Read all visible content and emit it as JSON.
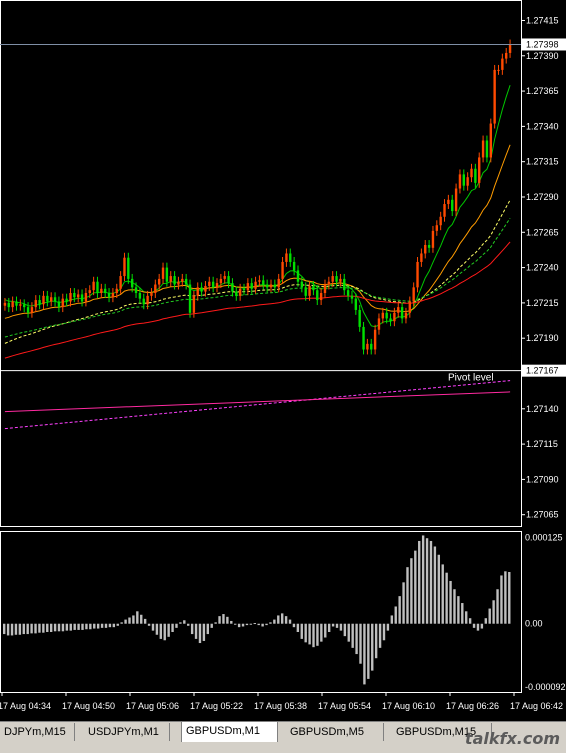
{
  "chart_data": [
    {
      "type": "candlestick",
      "symbol": "GBPUSDm,M1",
      "price_axis": {
        "ticks": [
          "1.27415",
          "1.27390",
          "1.27365",
          "1.27340",
          "1.27315",
          "1.27290",
          "1.27265",
          "1.27240",
          "1.27215",
          "1.27190",
          "1.27140",
          "1.27115",
          "1.27090",
          "1.27065"
        ],
        "range": [
          1.27057,
          1.27421
        ]
      },
      "current_price": "1.27398",
      "pivot": {
        "label": "Pivot level",
        "value": "1.27167"
      },
      "time_labels": [
        "17 Aug 04:34",
        "17 Aug 04:50",
        "17 Aug 05:06",
        "17 Aug 05:22",
        "17 Aug 05:38",
        "17 Aug 05:54",
        "17 Aug 06:10",
        "17 Aug 06:26",
        "17 Aug 06:42"
      ],
      "bull_color": "#ff4a00",
      "bear_color": "#00e000",
      "closes": [
        1.27215,
        1.27212,
        1.27216,
        1.27213,
        1.27214,
        1.27212,
        1.27208,
        1.27212,
        1.27217,
        1.27214,
        1.2722,
        1.27216,
        1.27219,
        1.27216,
        1.27212,
        1.27218,
        1.27216,
        1.27222,
        1.27219,
        1.27221,
        1.27216,
        1.27222,
        1.27224,
        1.2723,
        1.27222,
        1.27225,
        1.27222,
        1.27219,
        1.27222,
        1.27225,
        1.27234,
        1.27247,
        1.27232,
        1.27226,
        1.27222,
        1.27218,
        1.27214,
        1.2722,
        1.27222,
        1.27228,
        1.27232,
        1.2724,
        1.2723,
        1.27234,
        1.27228,
        1.2723,
        1.27232,
        1.27228,
        1.27208,
        1.2722,
        1.27226,
        1.27223,
        1.27227,
        1.2723,
        1.27226,
        1.27229,
        1.27232,
        1.27234,
        1.27229,
        1.27223,
        1.2722,
        1.27225,
        1.27224,
        1.27229,
        1.27225,
        1.2723,
        1.27231,
        1.27228,
        1.27226,
        1.27228,
        1.27226,
        1.27232,
        1.27244,
        1.2725,
        1.27244,
        1.27238,
        1.2723,
        1.27226,
        1.2722,
        1.27227,
        1.27224,
        1.27217,
        1.27222,
        1.27228,
        1.2723,
        1.27234,
        1.2723,
        1.27232,
        1.27224,
        1.2722,
        1.27218,
        1.2721,
        1.27198,
        1.27182,
        1.27186,
        1.27182,
        1.27196,
        1.27204,
        1.27208,
        1.27204,
        1.27202,
        1.27208,
        1.27212,
        1.27204,
        1.27208,
        1.27216,
        1.27226,
        1.27244,
        1.2725,
        1.27256,
        1.27254,
        1.27266,
        1.2727,
        1.27276,
        1.27285,
        1.27288,
        1.2728,
        1.27296,
        1.27306,
        1.27298,
        1.27304,
        1.2731,
        1.273,
        1.27318,
        1.2733,
        1.27318,
        1.27342,
        1.2738,
        1.2738,
        1.27388,
        1.27392,
        1.27398
      ],
      "moving_averages": [
        {
          "color": "#00c800",
          "style": "solid"
        },
        {
          "color": "#ff9c00",
          "style": "solid"
        },
        {
          "color": "#ffff66",
          "style": "dashed"
        },
        {
          "color": "#ff1a1a",
          "style": "solid"
        },
        {
          "color": "#22cc22",
          "style": "dashed"
        },
        {
          "color": "#ff40ff",
          "style": "dashed"
        },
        {
          "color": "#ff2aa0",
          "style": "solid"
        }
      ]
    },
    {
      "type": "histogram",
      "indicator_axis": {
        "ticks": [
          "0.000125",
          "0.00",
          "-0.000092"
        ],
        "range": [
          -9.9e-05,
          0.000133
        ]
      },
      "color": "#bfbfbf",
      "values": [
        -1.5e-05,
        -1.7e-05,
        -1.7e-05,
        -1.6e-05,
        -1.6e-05,
        -1.5e-05,
        -1.5e-05,
        -1.4e-05,
        -1.4e-05,
        -1.3e-05,
        -1.3e-05,
        -1.2e-05,
        -1.2e-05,
        -1.1e-05,
        -1.1e-05,
        -1.1e-05,
        -1e-05,
        -1e-05,
        -9e-06,
        -9e-06,
        -9e-06,
        -8e-06,
        -8e-06,
        -7e-06,
        -7e-06,
        -6e-06,
        -6e-06,
        -5e-06,
        -5e-06,
        -3e-06,
        2e-06,
        6e-06,
        9e-06,
        1.2e-05,
        1.8e-05,
        1.3e-05,
        7e-06,
        -3e-06,
        -1e-05,
        -1.6e-05,
        -2.2e-05,
        -2.4e-05,
        -1.9e-05,
        -1.2e-05,
        -6e-06,
        2e-06,
        5e-06,
        -3e-06,
        -1.5e-05,
        -2.2e-05,
        -2.8e-05,
        -2.5e-05,
        -1.5e-05,
        -6e-06,
        2e-06,
        1.1e-05,
        1.4e-05,
        1e-05,
        4e-06,
        -1e-06,
        -5e-06,
        -4e-06,
        -2e-06,
        0.0,
        1e-06,
        -2e-06,
        -4e-06,
        -2e-06,
        2e-06,
        6e-06,
        1.2e-05,
        1.5e-05,
        1.1e-05,
        6e-06,
        -5e-06,
        -1.2e-05,
        -2.2e-05,
        -2.7e-05,
        -3e-05,
        -3.4e-05,
        -3.2e-05,
        -2.6e-05,
        -2e-05,
        -1.2e-05,
        -4e-06,
        -6e-06,
        -1e-05,
        -1.8e-05,
        -2.6e-05,
        -3.5e-05,
        -4.4e-05,
        -5.8e-05,
        -8.8e-05,
        -8e-05,
        -6.8e-05,
        -5e-05,
        -3.5e-05,
        -2.4e-05,
        -1e-05,
        1.2e-05,
        2.5e-05,
        4e-05,
        6e-05,
        8.2e-05,
        9.5e-05,
        0.000106,
        0.00012,
        0.000128,
        0.000124,
        0.00012,
        0.000112,
        0.0001,
        8.6e-05,
        7.4e-05,
        6.2e-05,
        5e-05,
        4e-05,
        3e-05,
        1.8e-05,
        8e-06,
        -6e-06,
        -1e-05,
        -7e-06,
        8e-06,
        2.2e-05,
        3.4e-05,
        5e-05,
        7e-05,
        7.6e-05,
        7.5e-05
      ]
    }
  ],
  "tabs": [
    "DJPYm,M15",
    "USDJPYm,M1",
    "GBPUSDm,M1",
    "GBPUSDm,M5",
    "GBPUSDm,M15"
  ],
  "active_tab": "GBPUSDm,M1",
  "watermark": "talkfx.com"
}
